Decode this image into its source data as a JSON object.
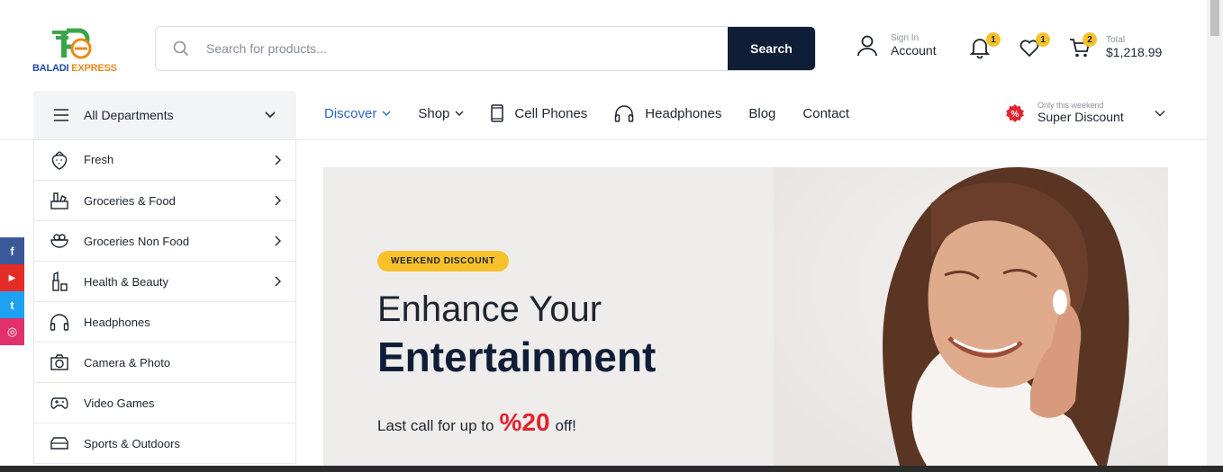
{
  "brand": {
    "name_part1": "BALADI",
    "name_part2": " EXPRESS"
  },
  "search": {
    "placeholder": "Search for products...",
    "button_label": "Search"
  },
  "account": {
    "small": "Sign In",
    "big": "Account"
  },
  "notifications": {
    "count": "1"
  },
  "wishlist": {
    "count": "1"
  },
  "cart": {
    "count": "2",
    "total_label": "Total",
    "total_value": "$1,218.99"
  },
  "departments": {
    "label": "All Departments"
  },
  "nav": {
    "items": [
      {
        "label": "Discover",
        "icon": "chevron-down-icon"
      },
      {
        "label": "Shop",
        "icon": "chevron-down-icon"
      },
      {
        "label": "Cell Phones",
        "icon": "phone-icon"
      },
      {
        "label": "Headphones",
        "icon": "headphones-icon"
      },
      {
        "label": "Blog"
      },
      {
        "label": "Contact"
      }
    ]
  },
  "promo": {
    "small": "Only this weekend",
    "big": "Super Discount"
  },
  "menu": {
    "items": [
      {
        "label": "Fresh",
        "icon": "strawberry-icon",
        "has_sub": true
      },
      {
        "label": "Groceries & Food",
        "icon": "groceries-icon",
        "has_sub": true
      },
      {
        "label": "Groceries Non Food",
        "icon": "bowl-icon",
        "has_sub": true
      },
      {
        "label": "Health & Beauty",
        "icon": "lipstick-icon",
        "has_sub": true
      },
      {
        "label": "Headphones",
        "icon": "headphones-icon",
        "has_sub": false
      },
      {
        "label": "Camera & Photo",
        "icon": "camera-icon",
        "has_sub": false
      },
      {
        "label": "Video Games",
        "icon": "gamepad-icon",
        "has_sub": false
      },
      {
        "label": "Sports & Outdoors",
        "icon": "sports-icon",
        "has_sub": false
      }
    ]
  },
  "social": [
    "f",
    "▶",
    "t",
    "◎"
  ],
  "hero": {
    "tag": "WEEKEND DISCOUNT",
    "line1": "Enhance Your",
    "line2": "Entertainment",
    "sub_before": "Last call for up to",
    "sub_pct": "%20",
    "sub_after": "off!"
  },
  "colors": {
    "primary_dark": "#0f1e36",
    "accent_yellow": "#f8c12c",
    "accent_red": "#e3232f",
    "link_blue": "#2a66c7"
  }
}
